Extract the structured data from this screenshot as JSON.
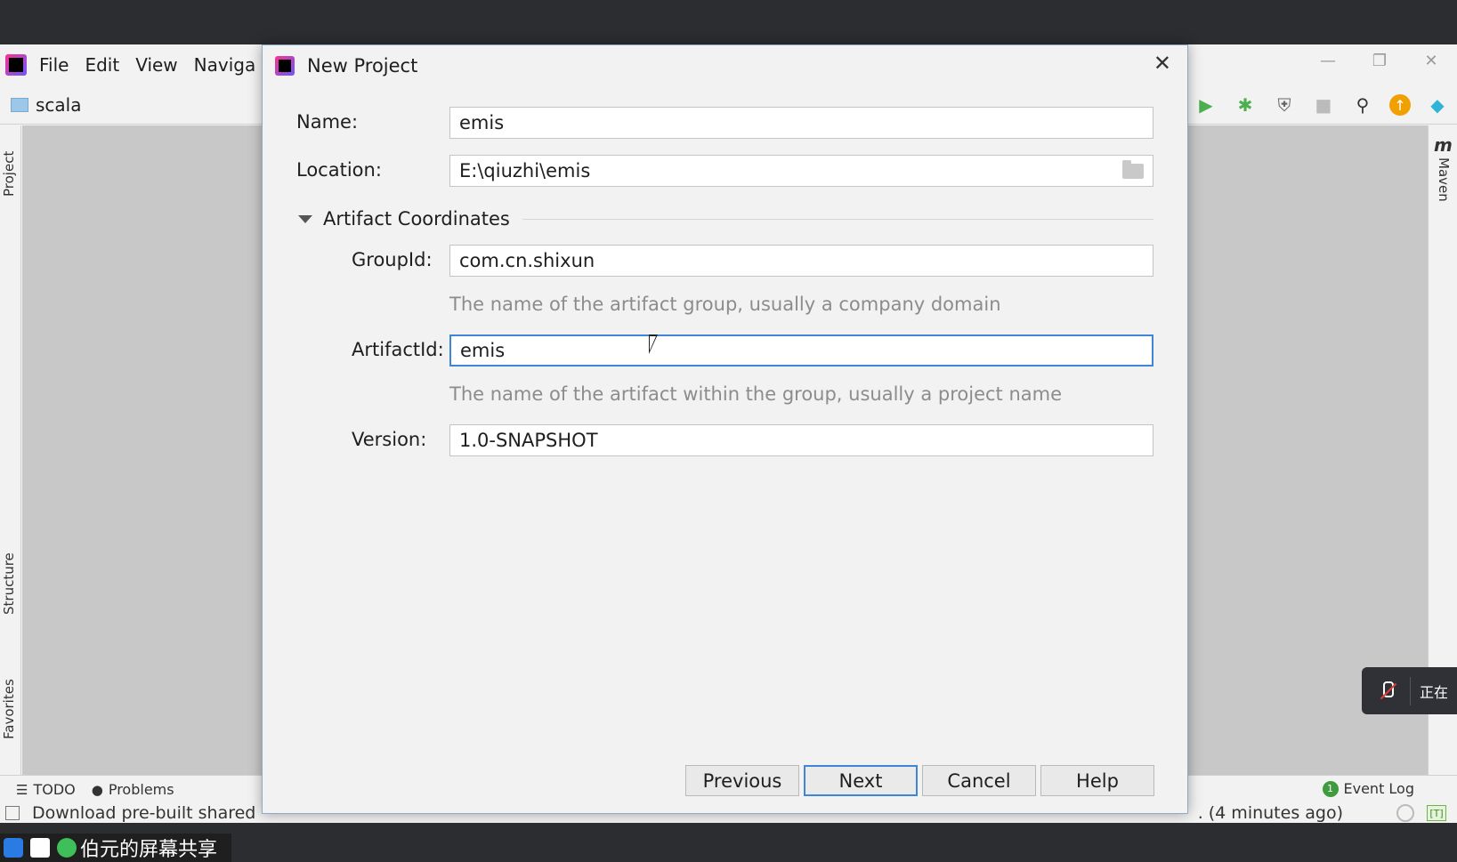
{
  "ide": {
    "menu": [
      "File",
      "Edit",
      "View",
      "Naviga"
    ],
    "project_name": "scala",
    "left_tabs": [
      "Project",
      "Structure",
      "Favorites"
    ],
    "right_tabs": [
      "Maven"
    ],
    "maven_glyph": "m",
    "bottom_tabs": [
      "TODO",
      "Problems"
    ],
    "event_log": "Event Log",
    "event_count": "1",
    "status_text": "Download pre-built shared",
    "status_time": ". (4 minutes ago)",
    "status_badge": "[T]"
  },
  "dialog": {
    "title": "New Project",
    "name_label": "Name:",
    "name_value": "emis",
    "location_label": "Location:",
    "location_value": "E:\\qiuzhi\\emis",
    "section_title": "Artifact Coordinates",
    "groupid_label": "GroupId:",
    "groupid_value": "com.cn.shixun",
    "groupid_hint": "The name of the artifact group, usually a company domain",
    "artifactid_label": "ArtifactId:",
    "artifactid_value": "emis",
    "artifactid_hint": "The name of the artifact within the group, usually a project name",
    "version_label": "Version:",
    "version_value": "1.0-SNAPSHOT",
    "buttons": {
      "previous": "Previous",
      "next": "Next",
      "cancel": "Cancel",
      "help": "Help"
    }
  },
  "share": {
    "toast_text": "正在",
    "taskbar_label": "伯元的屏幕共享"
  },
  "colors": {
    "focus_border": "#3f87d6",
    "dialog_bg": "#f2f2f2",
    "hint_text": "#8c8c8c"
  }
}
